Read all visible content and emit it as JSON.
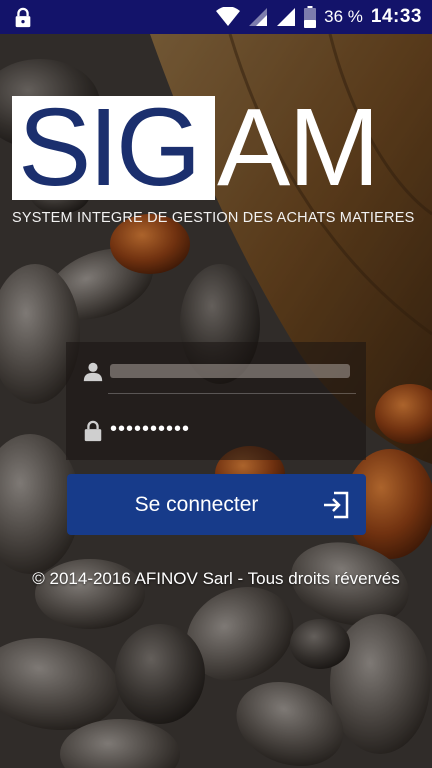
{
  "status_bar": {
    "battery_percent": "36 %",
    "time": "14:33",
    "icons": [
      "lock-icon",
      "wifi-icon",
      "signal-icon",
      "signal-icon",
      "battery-icon"
    ]
  },
  "logo": {
    "sig": "SIG",
    "am": "AM",
    "subtitle": "SYSTEM INTEGRE DE GESTION DES ACHATS MATIERES"
  },
  "login": {
    "username_icon": "user-icon",
    "username_value": "",
    "password_icon": "lock-icon",
    "password_masked": "••••••••••"
  },
  "button": {
    "label": "Se connecter",
    "icon": "sign-in-icon",
    "color": "#173b8a"
  },
  "footer": {
    "copyright": "© 2014-2016 AFINOV Sarl - Tous droits révervés"
  },
  "colors": {
    "status_bar": "#13136a",
    "logo_blue": "#1b2f6e"
  }
}
